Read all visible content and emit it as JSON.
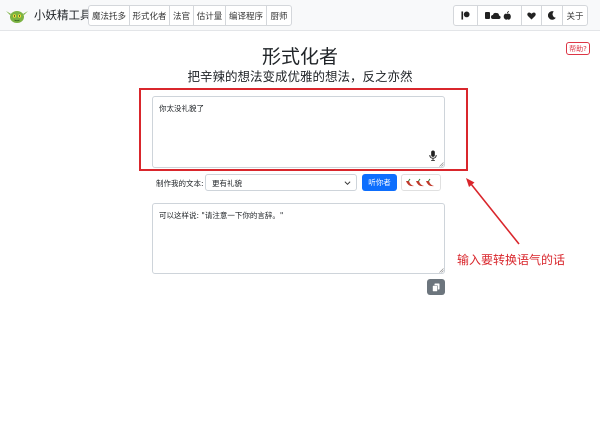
{
  "brand": {
    "name": "小妖精工具",
    "logo_icon": "goblin-logo-icon"
  },
  "nav": {
    "left_items": [
      "魔法托多",
      "形式化者",
      "法官",
      "估计量",
      "编译程序",
      "厨师"
    ],
    "about_label": "关于",
    "right_icons": [
      "patreon-icon",
      "cloud-apple-icon",
      "heart-icon",
      "moon-icon"
    ]
  },
  "help_label": "帮助?",
  "page": {
    "title": "形式化者",
    "subtitle": "把辛辣的想法变成优雅的想法，反之亦然"
  },
  "input": {
    "value": "你太没礼貌了",
    "mic_icon": "microphone-icon"
  },
  "controls": {
    "label": "制作我的文本:",
    "select_value": "更有礼貌",
    "go_label": "听你者",
    "spiciness_icons": [
      "chili-pepper-icon",
      "chili-pepper-icon",
      "chili-pepper-icon"
    ]
  },
  "output": {
    "value": "可以这样说: \"请注意一下你的言辞。\""
  },
  "copy_icon": "copy-icon",
  "annotation": {
    "text": "输入要转换语气的话",
    "color": "#d9262c"
  },
  "colors": {
    "primary": "#0d6efd",
    "accent_red": "#d9262c",
    "secondary": "#6c757d"
  }
}
